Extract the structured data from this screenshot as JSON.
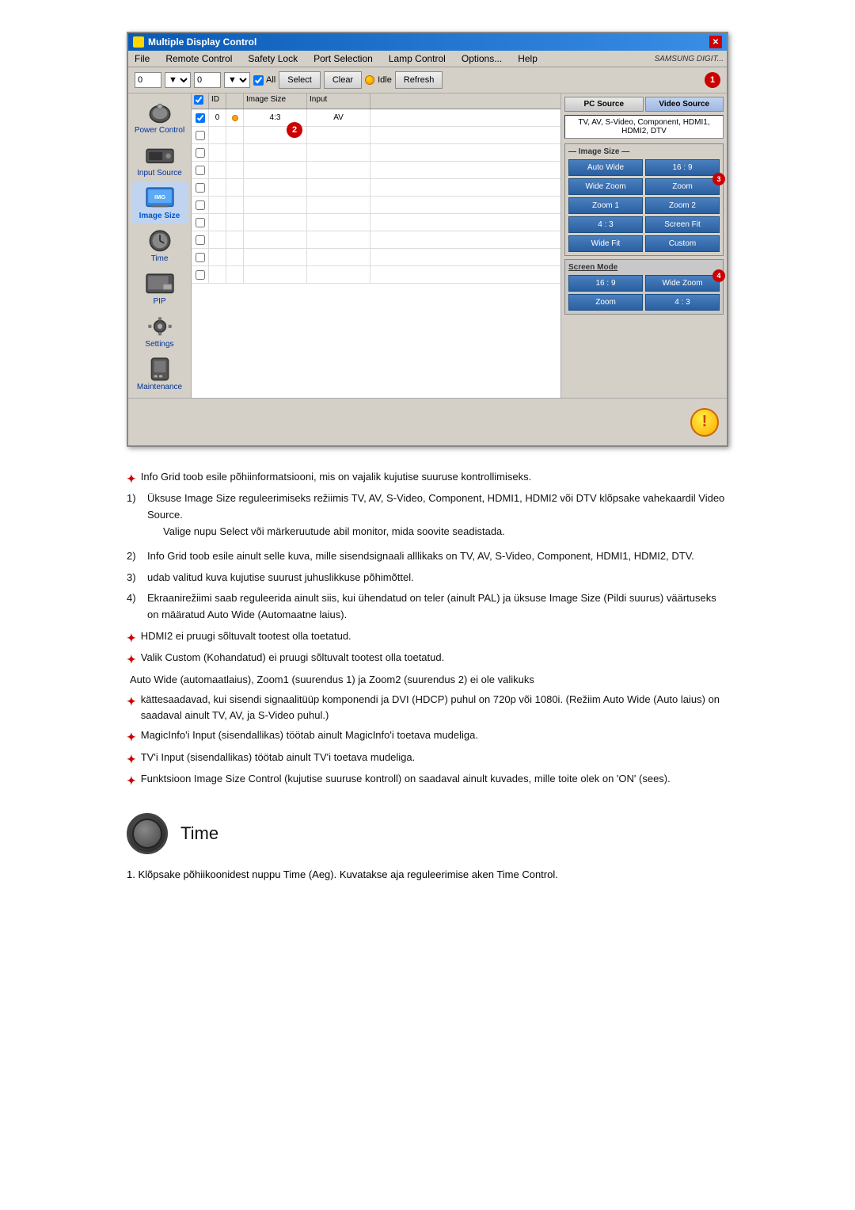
{
  "window": {
    "title": "Multiple Display Control",
    "close_label": "✕"
  },
  "menu": {
    "items": [
      "File",
      "Remote Control",
      "Safety Lock",
      "Port Selection",
      "Lamp Control",
      "Options...",
      "Help"
    ],
    "brand": "SAMSUNG DIGIT..."
  },
  "toolbar": {
    "input1_value": "0",
    "input2_value": "0",
    "all_label": "All",
    "select_label": "Select",
    "clear_label": "Clear",
    "idle_label": "Idle",
    "refresh_label": "Refresh"
  },
  "grid": {
    "headers": [
      "",
      "ID",
      "",
      "Image Size",
      "Input"
    ],
    "rows": [
      {
        "checked": true,
        "id": "0",
        "dot": true,
        "image_size": "4:3",
        "input": "AV"
      },
      {
        "checked": false,
        "id": "",
        "dot": false,
        "image_size": "",
        "input": ""
      },
      {
        "checked": false,
        "id": "",
        "dot": false,
        "image_size": "",
        "input": ""
      },
      {
        "checked": false,
        "id": "",
        "dot": false,
        "image_size": "",
        "input": ""
      },
      {
        "checked": false,
        "id": "",
        "dot": false,
        "image_size": "",
        "input": ""
      },
      {
        "checked": false,
        "id": "",
        "dot": false,
        "image_size": "",
        "input": ""
      },
      {
        "checked": false,
        "id": "",
        "dot": false,
        "image_size": "",
        "input": ""
      },
      {
        "checked": false,
        "id": "",
        "dot": false,
        "image_size": "",
        "input": ""
      },
      {
        "checked": false,
        "id": "",
        "dot": false,
        "image_size": "",
        "input": ""
      },
      {
        "checked": false,
        "id": "",
        "dot": false,
        "image_size": "",
        "input": ""
      }
    ]
  },
  "right_panel": {
    "pc_source_label": "PC Source",
    "video_source_label": "Video Source",
    "source_info": "TV, AV, S-Video, Component, HDMI1, HDMI2, DTV",
    "image_size_group_title": "Image Size",
    "image_size_buttons": [
      "Auto Wide",
      "16 : 9",
      "Wide Zoom",
      "Zoom",
      "Zoom 1",
      "Zoom 2",
      "4 : 3",
      "Screen Fit",
      "Wide Fit",
      "Custom"
    ],
    "screen_mode_title": "Screen Mode",
    "screen_mode_buttons": [
      "16 : 9",
      "Wide Zoom",
      "Zoom",
      "4 : 3"
    ]
  },
  "sidebar": {
    "items": [
      {
        "label": "Power Control",
        "id": "power"
      },
      {
        "label": "Input Source",
        "id": "input"
      },
      {
        "label": "Image Size",
        "id": "imagesize"
      },
      {
        "label": "Time",
        "id": "time"
      },
      {
        "label": "PIP",
        "id": "pip"
      },
      {
        "label": "Settings",
        "id": "settings"
      },
      {
        "label": "Maintenance",
        "id": "maintenance"
      }
    ]
  },
  "badges": {
    "badge1": "1",
    "badge2": "2",
    "badge3": "3",
    "badge4": "4"
  },
  "text_content": {
    "star_items": [
      "Info Grid toob esile põhiinformatsiooni, mis on vajalik kujutise suuruse kontrollimiseks.",
      "HDMI2 ei pruugi sõltuvalt tootest olla toetatud.",
      "Valik Custom (Kohandatud) ei pruugi sõltuvalt tootest olla toetatud.",
      "kättesaadavad, kui sisendi signaalitüüp komponendi ja DVI (HDCP) puhul on 720p või 1080i. (Režiim Auto Wide (Auto laius) on saadaval ainult TV, AV, ja S-Video puhul.)",
      "MagicInfo'i Input (sisendallikas) töötab ainult MagicInfo'i toetava mudeliga.",
      "TV'i Input (sisendallikas) töötab ainult TV'i toetava mudeliga.",
      "Funktsioon Image Size Control (kujutise suuruse kontroll) on saadaval ainult kuvades, mille toite olek on 'ON' (sees)."
    ],
    "numbered_items": [
      {
        "num": "1)",
        "main": "Üksuse Image Size reguleerimiseks režiimis TV, AV, S-Video, Component, HDMI1, HDMI2 või DTV klõpsake vahekaardil Video Source.",
        "sub": "Valige nupu Select või märkeruutude abil monitor, mida soovite seadistada."
      },
      {
        "num": "2)",
        "main": "Info Grid toob esile ainult selle kuva, mille sisendsignaali alllikaks on TV, AV, S-Video, Component, HDMI1, HDMI2, DTV.",
        "sub": ""
      },
      {
        "num": "3)",
        "main": "udab valitud kuva kujutise suurust juhuslikkuse põhimõttel.",
        "sub": ""
      },
      {
        "num": "4)",
        "main": "Ekraanirežiimi saab reguleerida ainult siis, kui ühendatud on teler (ainult PAL) ja üksuse Image Size (Pildi suurus) väärtuseks on määratud Auto Wide (Automaatne laius).",
        "sub": ""
      }
    ],
    "auto_wide_note": "Auto Wide (automaatlaius), Zoom1 (suurendus 1) ja Zoom2 (suurendus 2) ei ole valikuks"
  },
  "time_section": {
    "title": "Time",
    "note": "1.  Klõpsake põhiikoonidest nuppu Time (Aeg). Kuvatakse aja reguleerimise aken Time Control."
  }
}
